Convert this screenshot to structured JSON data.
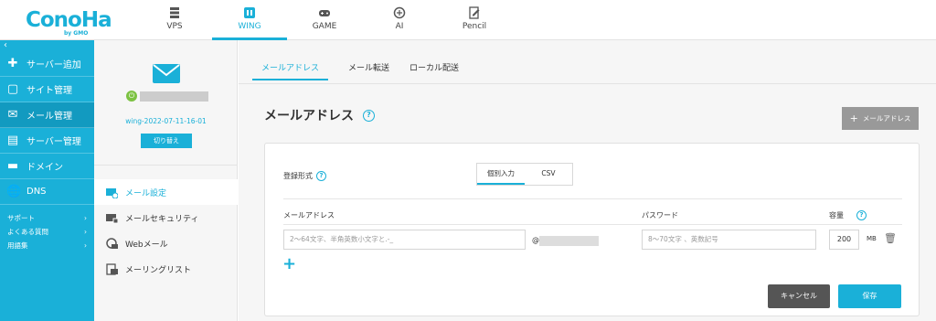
{
  "logo": {
    "text": "ConoHa",
    "sub": "by GMO"
  },
  "topnav": [
    {
      "label": "VPS",
      "icon": "server-icon"
    },
    {
      "label": "WING",
      "icon": "wing-icon",
      "active": true
    },
    {
      "label": "GAME",
      "icon": "gamepad-icon"
    },
    {
      "label": "AI",
      "icon": "ai-chip-icon"
    },
    {
      "label": "Pencil",
      "icon": "pencil-icon"
    }
  ],
  "sidebar": {
    "collapse": "‹",
    "items": [
      {
        "label": "サーバー追加",
        "icon": "plus-icon"
      },
      {
        "label": "サイト管理",
        "icon": "window-icon"
      },
      {
        "label": "メール管理",
        "icon": "mail-icon",
        "active": true
      },
      {
        "label": "サーバー管理",
        "icon": "server-stack-icon"
      },
      {
        "label": "ドメイン",
        "icon": "domain-icon"
      },
      {
        "label": "DNS",
        "icon": "globe-icon"
      }
    ],
    "sub_items": [
      {
        "label": "サポート",
        "chevron": "›"
      },
      {
        "label": "よくある質問",
        "chevron": "›"
      },
      {
        "label": "用語集",
        "chevron": "›"
      }
    ]
  },
  "account": {
    "id": "wing-2022-07-11-16-01",
    "switch_label": "切り替え",
    "status_glyph": "⏻"
  },
  "submenu": [
    {
      "label": "メール設定",
      "icon": "mail-settings-icon",
      "active": true
    },
    {
      "label": "メールセキュリティ",
      "icon": "mail-security-icon"
    },
    {
      "label": "Webメール",
      "icon": "webmail-icon"
    },
    {
      "label": "メーリングリスト",
      "icon": "mailing-list-icon"
    }
  ],
  "tabs": [
    {
      "label": "メールアドレス",
      "active": true
    },
    {
      "label": "メール転送"
    },
    {
      "label": "ローカル配送"
    }
  ],
  "heading": "メールアドレス",
  "help_glyph": "?",
  "add_button": {
    "label": "メールアドレス",
    "plus": "+"
  },
  "form": {
    "reg_label": "登録形式",
    "seg_options": [
      {
        "label": "個別入力",
        "active": true
      },
      {
        "label": "CSV"
      }
    ],
    "col_email": "メールアドレス",
    "col_password": "パスワード",
    "col_capacity": "容量",
    "email_placeholder": "2～64文字、半角英数小文字と.-_",
    "at": "@",
    "password_placeholder": "8～70文字 、英数記号",
    "capacity": "200",
    "capacity_unit": "MB",
    "trash_glyph": "🗑",
    "add_row_glyph": "+",
    "cancel_label": "キャンセル",
    "save_label": "保存"
  },
  "colors": {
    "accent": "#1ab0d8",
    "gray_button": "#999999",
    "cancel": "#555555"
  }
}
